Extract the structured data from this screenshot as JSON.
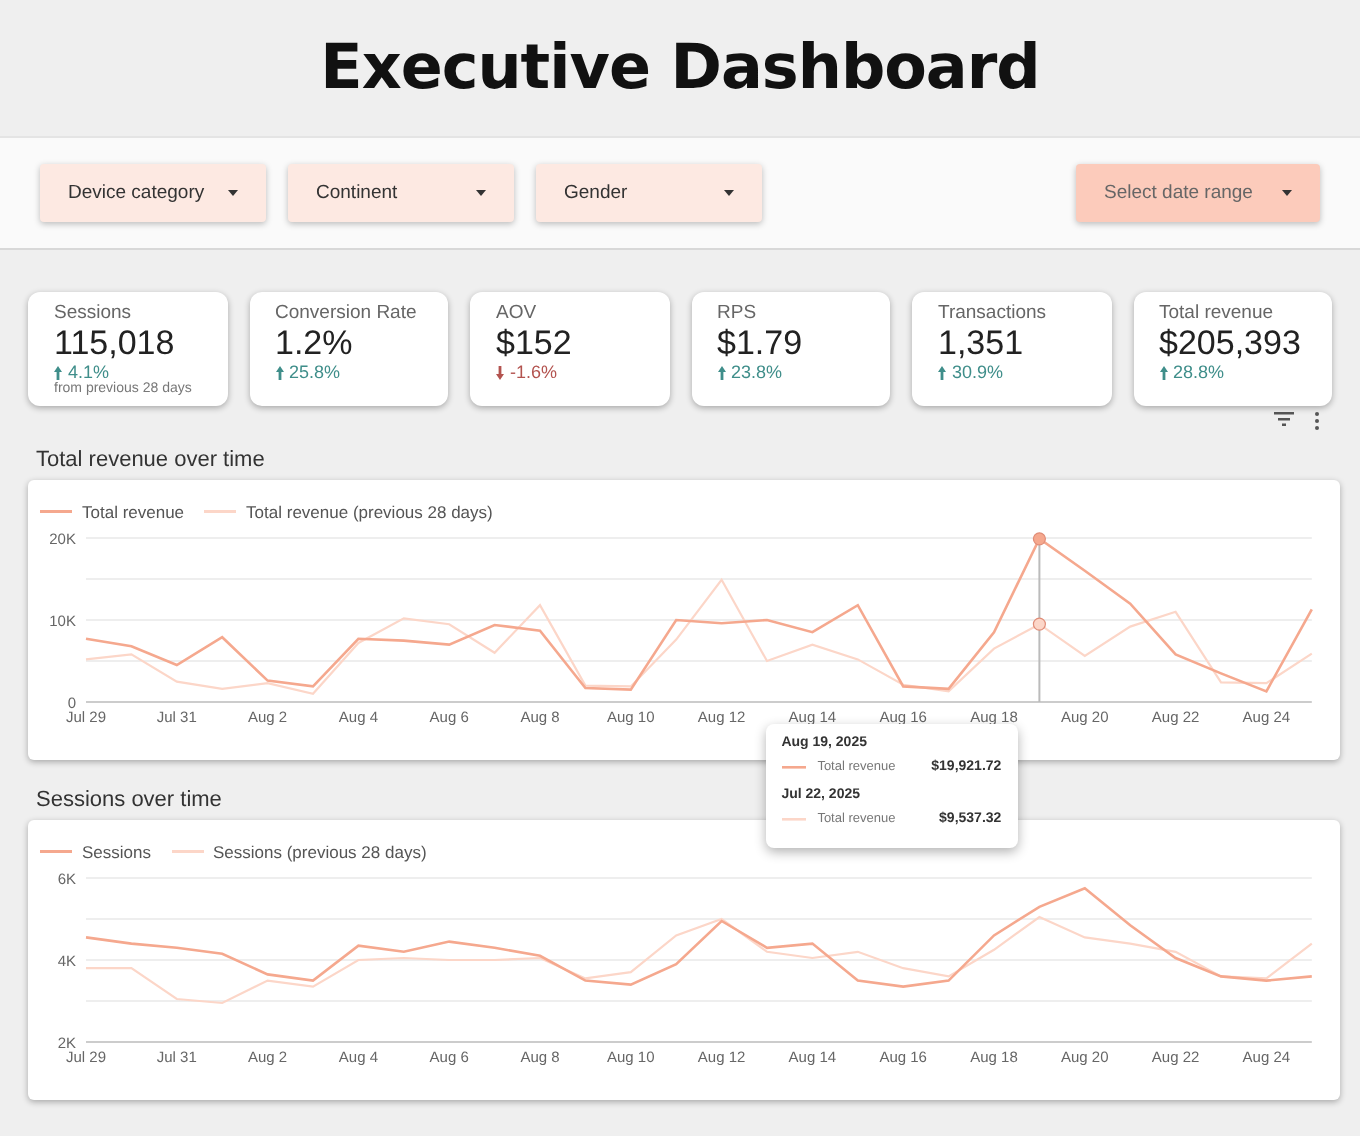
{
  "header": {
    "title": "Executive Dashboard"
  },
  "filters": [
    {
      "label": "Device category",
      "kind": "filter"
    },
    {
      "label": "Continent",
      "kind": "filter"
    },
    {
      "label": "Gender",
      "kind": "filter"
    },
    {
      "label": "Select date range",
      "kind": "date"
    }
  ],
  "kpis": [
    {
      "label": "Sessions",
      "value": "115,018",
      "change": "4.1%",
      "up": true,
      "note": "from previous 28 days"
    },
    {
      "label": "Conversion Rate",
      "value": "1.2%",
      "change": "25.8%",
      "up": true
    },
    {
      "label": "AOV",
      "value": "$152",
      "change": "-1.6%",
      "up": false
    },
    {
      "label": "RPS",
      "value": "$1.79",
      "change": "23.8%",
      "up": true
    },
    {
      "label": "Transactions",
      "value": "1,351",
      "change": "30.9%",
      "up": true
    },
    {
      "label": "Total revenue",
      "value": "$205,393",
      "change": "28.8%",
      "up": true
    }
  ],
  "charts": [
    {
      "title": "Total revenue over time",
      "chart_data": {
        "type": "line",
        "categories": [
          "Jul 29",
          null,
          "Jul 31",
          null,
          "Aug 2",
          null,
          "Aug 4",
          null,
          "Aug 6",
          null,
          "Aug 8",
          null,
          "Aug 10",
          null,
          "Aug 12",
          null,
          "Aug 14",
          null,
          "Aug 16",
          null,
          "Aug 18",
          null,
          "Aug 20",
          null,
          "Aug 22",
          null,
          "Aug 24",
          null
        ],
        "ylim": [
          0,
          20000
        ],
        "yticks": [
          {
            "value": 0,
            "label": "0"
          },
          {
            "value": 10000,
            "label": "10K"
          },
          {
            "value": 20000,
            "label": "20K"
          }
        ],
        "series": [
          {
            "name": "Total revenue",
            "color": "#f5a88e",
            "values": [
              7700,
              6800,
              4500,
              7900,
              2600,
              1900,
              7700,
              7500,
              7000,
              9400,
              8700,
              1700,
              1500,
              10000,
              9600,
              10000,
              8500,
              11800,
              1900,
              1600,
              8500,
              19900,
              16000,
              12000,
              5800,
              3500,
              1300,
              11300
            ]
          },
          {
            "name": "Total revenue (previous 28 days)",
            "color": "#fcd6c8",
            "values": [
              5200,
              5800,
              2500,
              1600,
              2300,
              1000,
              7200,
              10200,
              9500,
              6000,
              11800,
              2000,
              1900,
              7600,
              14900,
              5000,
              7000,
              5200,
              2100,
              1300,
              6500,
              9500,
              5600,
              9200,
              11000,
              2400,
              2300,
              5900
            ]
          }
        ]
      },
      "tooltip": {
        "entries": [
          {
            "date": "Aug 19, 2025",
            "series": "Total revenue",
            "value": "$19,921.72"
          },
          {
            "date": "Jul 22, 2025",
            "series": "Total revenue",
            "value": "$9,537.32"
          }
        ]
      }
    },
    {
      "title": "Sessions over time",
      "chart_data": {
        "type": "line",
        "categories": [
          "Jul 29",
          null,
          "Jul 31",
          null,
          "Aug 2",
          null,
          "Aug 4",
          null,
          "Aug 6",
          null,
          "Aug 8",
          null,
          "Aug 10",
          null,
          "Aug 12",
          null,
          "Aug 14",
          null,
          "Aug 16",
          null,
          "Aug 18",
          null,
          "Aug 20",
          null,
          "Aug 22",
          null,
          "Aug 24",
          null
        ],
        "ylim": [
          2000,
          6000
        ],
        "yticks": [
          {
            "value": 2000,
            "label": "2K"
          },
          {
            "value": 4000,
            "label": "4K"
          },
          {
            "value": 6000,
            "label": "6K"
          }
        ],
        "series": [
          {
            "name": "Sessions",
            "color": "#f5a88e",
            "values": [
              4550,
              4400,
              4300,
              4150,
              3650,
              3500,
              4350,
              4200,
              4450,
              4300,
              4100,
              3500,
              3400,
              3900,
              4950,
              4300,
              4400,
              3500,
              3350,
              3500,
              4600,
              5300,
              5750,
              4850,
              4050,
              3600,
              3500,
              3600
            ]
          },
          {
            "name": "Sessions (previous 28 days)",
            "color": "#fcd6c8",
            "values": [
              3800,
              3800,
              3050,
              2950,
              3500,
              3350,
              4000,
              4050,
              4000,
              4000,
              4050,
              3550,
              3700,
              4600,
              5000,
              4200,
              4050,
              4200,
              3800,
              3600,
              4250,
              5050,
              4550,
              4400,
              4200,
              3600,
              3550,
              4400
            ]
          }
        ]
      }
    }
  ]
}
